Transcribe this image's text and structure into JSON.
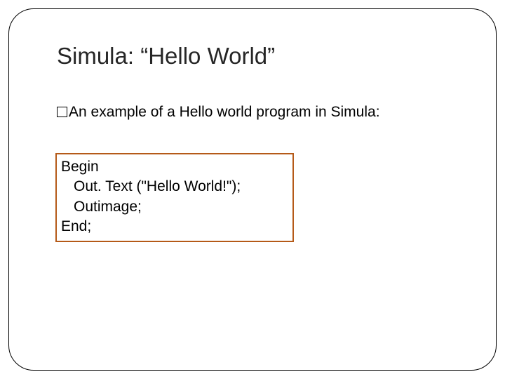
{
  "title": "Simula: “Hello World”",
  "bullet": "An example of a Hello world program in Simula:",
  "code": {
    "l1": "Begin",
    "l2": "Out. Text (\"Hello World!\");",
    "l3": "Outimage;",
    "l4": "End;"
  },
  "page": ""
}
